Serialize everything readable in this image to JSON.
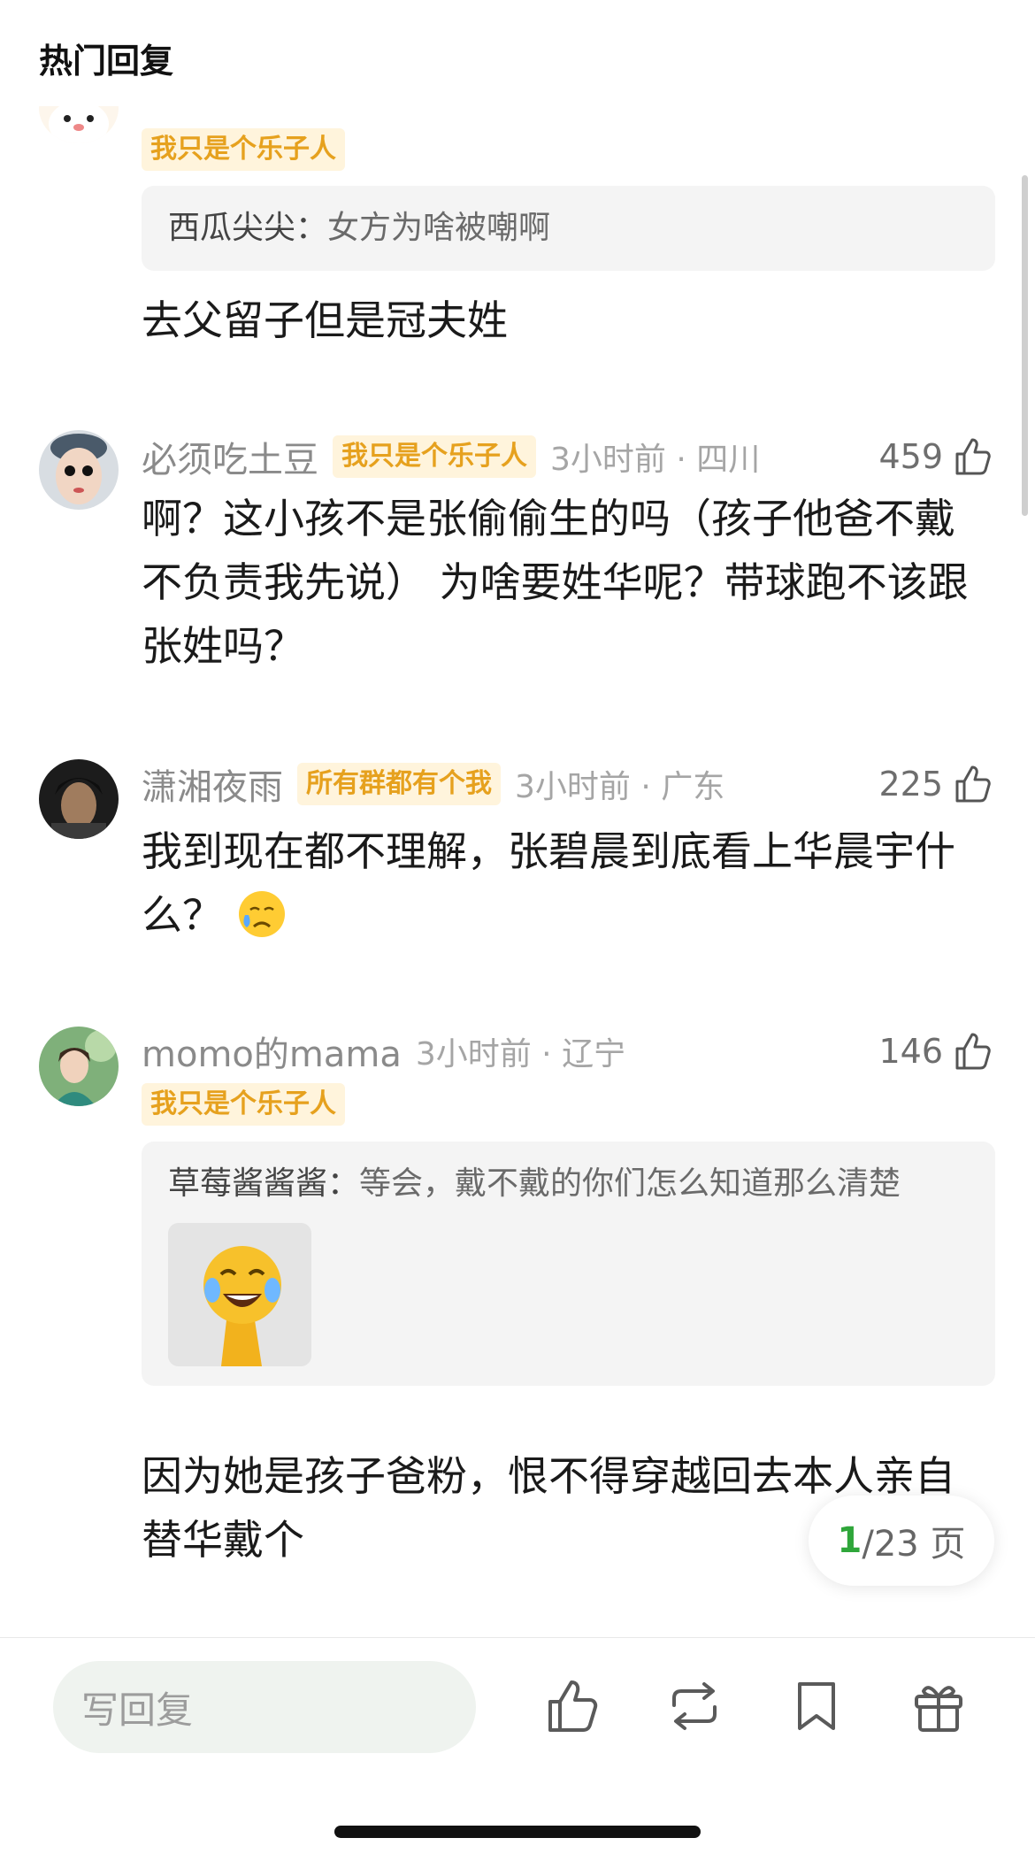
{
  "header": {
    "title": "热门回复"
  },
  "comments": [
    {
      "badge": "我只是个乐子人",
      "quote_name": "西瓜尖尖：",
      "quote_text": "女方为啥被嘲啊",
      "text": "去父留子但是冠夫姓"
    },
    {
      "username": "必须吃土豆",
      "badge": "我只是个乐子人",
      "time": "3小时前 · 四川",
      "likes": "459",
      "text": "啊？这小孩不是张偷偷生的吗（孩子他爸不戴不负责我先说） 为啥要姓华呢？带球跑不该跟张姓吗？"
    },
    {
      "username": "潇湘夜雨",
      "badge": "所有群都有个我",
      "time": "3小时前 · 广东",
      "likes": "225",
      "text": "我到现在都不理解，张碧晨到底看上华晨宇什么？"
    },
    {
      "username": "momo的mama",
      "badge": "我只是个乐子人",
      "time": "3小时前 · 辽宁",
      "likes": "146",
      "quote_name": "草莓酱酱酱：",
      "quote_text": "等会，戴不戴的你们怎么知道那么清楚",
      "text": "因为她是孩子爸粉，恨不得穿越回去本人亲自替华戴个"
    }
  ],
  "pager": {
    "current": "1",
    "rest": "/23 页"
  },
  "bottom_bar": {
    "reply_placeholder": "写回复",
    "icons": [
      "like-icon",
      "repost-icon",
      "bookmark-icon",
      "gift-icon"
    ]
  },
  "colors": {
    "badge_text": "#e6a11e",
    "badge_bg": "#fff4dc",
    "pager_current": "#2fa63a",
    "input_bg": "#eff3ef"
  }
}
